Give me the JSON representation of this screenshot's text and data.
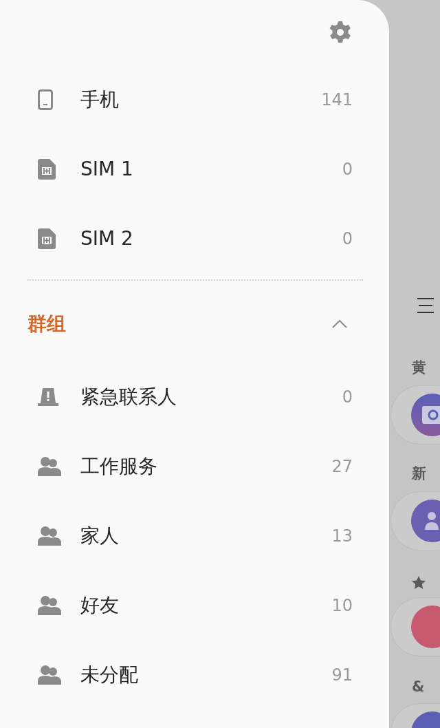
{
  "storage": [
    {
      "kind": "phone",
      "label": "手机",
      "count": "141"
    },
    {
      "kind": "sim",
      "label": "SIM 1",
      "count": "0"
    },
    {
      "kind": "sim",
      "label": "SIM 2",
      "count": "0"
    }
  ],
  "groups": {
    "title": "群组",
    "expanded": true,
    "items": [
      {
        "kind": "emergency",
        "label": "紧急联系人",
        "count": "0"
      },
      {
        "kind": "group",
        "label": "工作服务",
        "count": "27"
      },
      {
        "kind": "group",
        "label": "家人",
        "count": "13"
      },
      {
        "kind": "group",
        "label": "好友",
        "count": "10"
      },
      {
        "kind": "group",
        "label": "未分配",
        "count": "91"
      }
    ]
  },
  "background": {
    "sections": [
      {
        "kind": "text",
        "header": "黄",
        "avatar": {
          "kind": "book"
        }
      },
      {
        "kind": "text",
        "header": "新",
        "avatar": {
          "kind": "people"
        }
      },
      {
        "kind": "star",
        "avatar": {
          "kind": "plain",
          "color": "#c85a70"
        }
      },
      {
        "kind": "text",
        "header": "&",
        "avatar": {
          "kind": "plain",
          "color": "#5d5fb5"
        }
      }
    ]
  }
}
